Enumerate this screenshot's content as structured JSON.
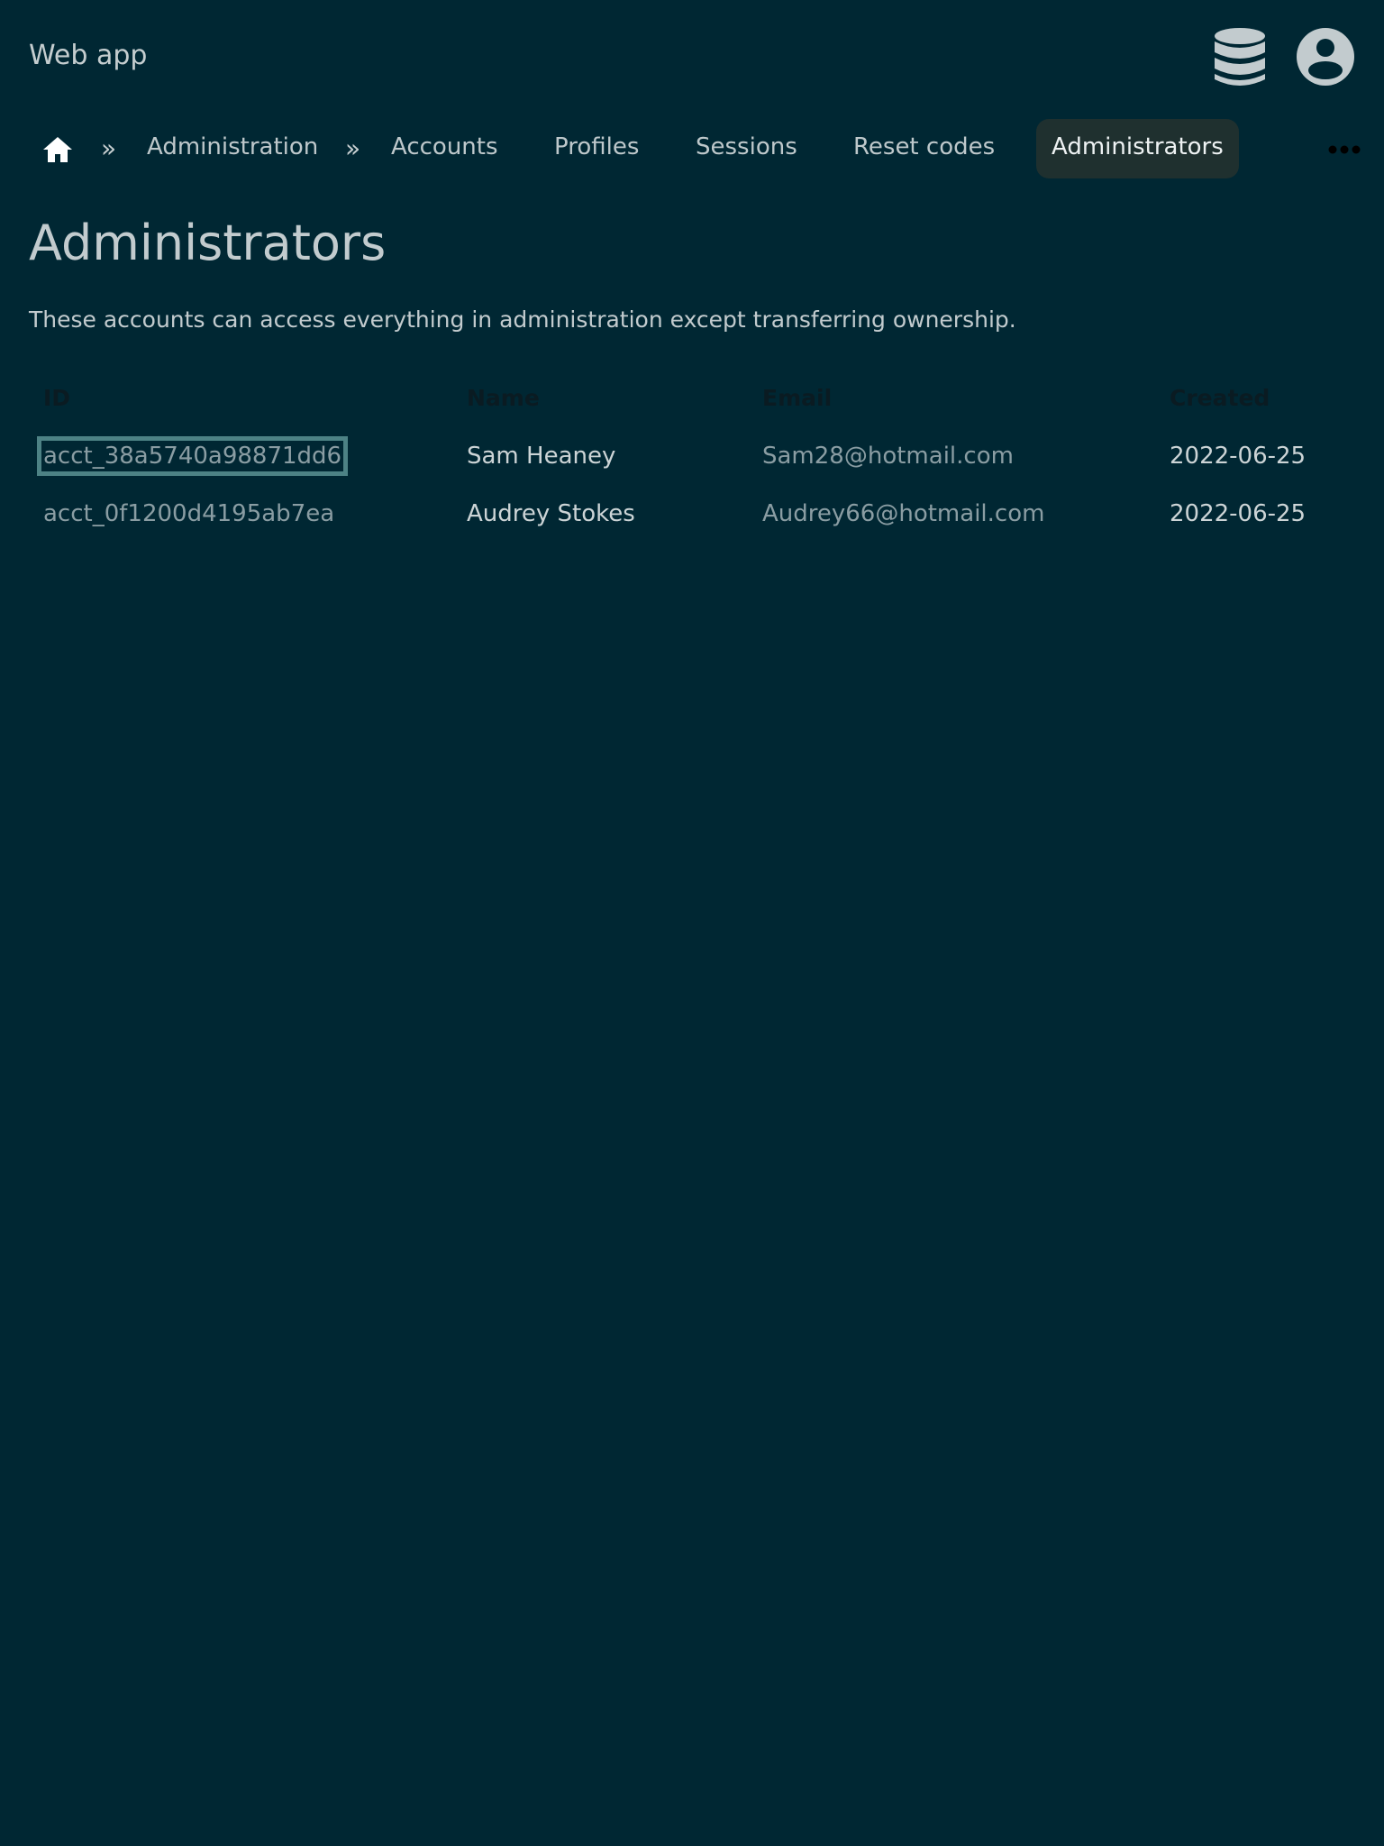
{
  "app": {
    "title": "Web app"
  },
  "breadcrumb": {
    "separator": "»",
    "items": [
      {
        "label": "Administration"
      }
    ]
  },
  "tabs": [
    {
      "label": "Accounts"
    },
    {
      "label": "Profiles"
    },
    {
      "label": "Sessions"
    },
    {
      "label": "Reset codes"
    },
    {
      "label": "Administrators",
      "active": true
    }
  ],
  "icons": {
    "home": "home-icon",
    "database": "database-icon",
    "user": "user-circle-icon",
    "more": "more-horizontal-icon"
  },
  "page": {
    "title": "Administrators",
    "description": "These accounts can access everything in administration except transferring ownership."
  },
  "table": {
    "columns": [
      "ID",
      "Name",
      "Email",
      "Created"
    ],
    "rows": [
      {
        "id": "acct_38a5740a98871dd6",
        "name": "Sam Heaney",
        "email": "Sam28@hotmail.com",
        "created": "2022-06-25"
      },
      {
        "id": "acct_0f1200d4195ab7ea",
        "name": "Audrey Stokes",
        "email": "Audrey66@hotmail.com",
        "created": "2022-06-25"
      }
    ]
  },
  "colors": {
    "background": "#002733",
    "active_tab": "#1f302f",
    "focus_outline": "#4d8285"
  }
}
